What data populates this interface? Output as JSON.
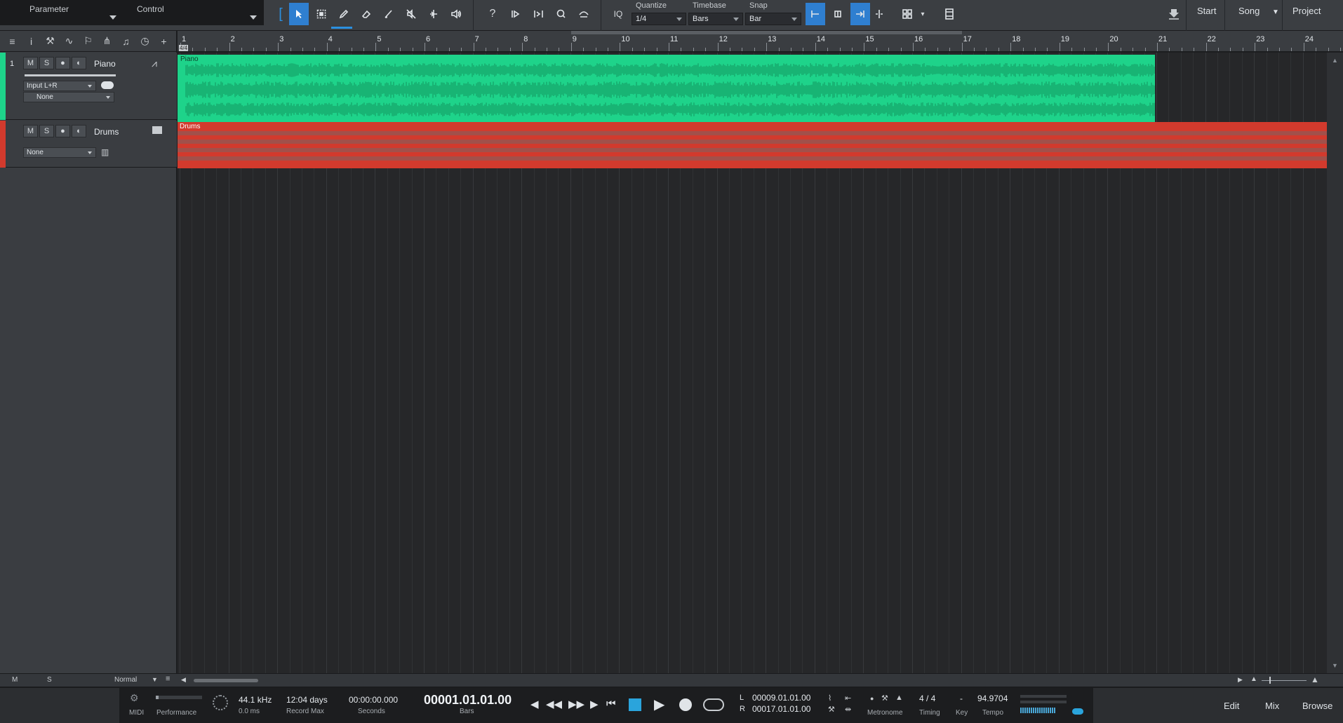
{
  "top": {
    "parameter_label": "Parameter",
    "control_label": "Control",
    "iq_label": "IQ",
    "quantize": {
      "label": "Quantize",
      "value": "1/4"
    },
    "timebase": {
      "label": "Timebase",
      "value": "Bars"
    },
    "snap": {
      "label": "Snap",
      "value": "Bar"
    },
    "start_label": "Start",
    "song_label": "Song",
    "project_label": "Project",
    "help_glyph": "?"
  },
  "ruler": {
    "bars": [
      "1",
      "2",
      "3",
      "4",
      "5",
      "6",
      "7",
      "8",
      "9",
      "10",
      "11",
      "12",
      "13",
      "14",
      "15",
      "16",
      "17",
      "18",
      "19",
      "20",
      "21",
      "22",
      "23",
      "24"
    ],
    "signature": "4/4",
    "loop_start_bar": 9,
    "loop_end_bar": 17
  },
  "tracks": [
    {
      "number": "1",
      "name": "Piano",
      "mute": "M",
      "solo": "S",
      "input": "Input L+R",
      "output": "None",
      "color": "#1ed38a",
      "event_label": "Piano"
    },
    {
      "number": "",
      "name": "Drums",
      "mute": "M",
      "solo": "S",
      "output": "None",
      "color": "#d23a2d",
      "event_label": "Drums"
    }
  ],
  "bottom": {
    "m_label": "M",
    "s_label": "S",
    "normal_label": "Normal"
  },
  "transport": {
    "midi_label": "MIDI",
    "performance_label": "Performance",
    "sample_rate": "44.1 kHz",
    "latency": "0.0 ms",
    "record_max_value": "12:04 days",
    "record_max_label": "Record Max",
    "seconds_value": "00:00:00.000",
    "seconds_label": "Seconds",
    "bars_value": "00001.01.01.00",
    "bars_label": "Bars",
    "left_loc_label": "L",
    "left_loc": "00009.01.01.00",
    "right_loc_label": "R",
    "right_loc": "00017.01.01.00",
    "metronome_label": "Metronome",
    "timing_value": "4 / 4",
    "timing_label": "Timing",
    "key_value": "-",
    "key_label": "Key",
    "tempo_value": "94.9704",
    "tempo_label": "Tempo",
    "edit_label": "Edit",
    "mix_label": "Mix",
    "browse_label": "Browse"
  },
  "colors": {
    "accent": "#2f7fd0",
    "piano": "#1ed38a",
    "drums": "#d23a2d"
  }
}
